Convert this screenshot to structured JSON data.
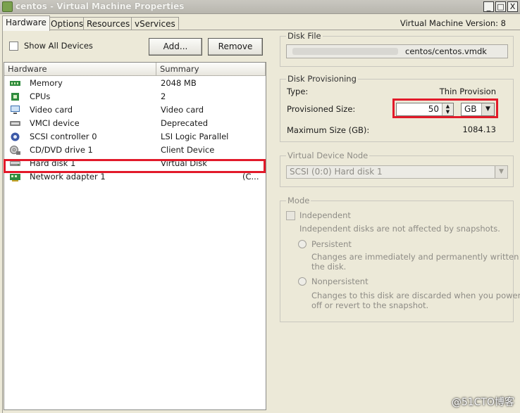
{
  "window": {
    "title": "centos - Virtual Machine Properties",
    "minimize": "_",
    "maximize": "□",
    "close": "X"
  },
  "tabs": [
    {
      "label": "Hardware",
      "active": true
    },
    {
      "label": "Options"
    },
    {
      "label": "Resources"
    },
    {
      "label": "vServices"
    }
  ],
  "vm_version": "Virtual Machine Version: 8",
  "show_all_devices": {
    "label": "Show All Devices",
    "checked": false
  },
  "buttons": {
    "add": "Add...",
    "remove": "Remove"
  },
  "hardware_table": {
    "columns": [
      "Hardware",
      "Summary"
    ],
    "rows": [
      {
        "name": "Memory",
        "summary": "2048 MB",
        "icon": "memory-icon"
      },
      {
        "name": "CPUs",
        "summary": "2",
        "icon": "cpu-icon"
      },
      {
        "name": "Video card",
        "summary": "Video card",
        "icon": "monitor-icon"
      },
      {
        "name": "VMCI device",
        "summary": "Deprecated",
        "icon": "vmci-device-icon"
      },
      {
        "name": "SCSI controller 0",
        "summary": "LSI Logic Parallel",
        "icon": "scsi-controller-icon"
      },
      {
        "name": "CD/DVD drive 1",
        "summary": "Client Device",
        "icon": "cd-dvd-icon"
      },
      {
        "name": "Hard disk 1",
        "summary": "Virtual Disk",
        "icon": "hard-disk-icon",
        "selected": true
      },
      {
        "name": "Network adapter 1",
        "summary": "(C...",
        "icon": "network-adapter-icon"
      }
    ]
  },
  "disk_file": {
    "group_label": "Disk File",
    "value": "centos/centos.vmdk"
  },
  "disk_provisioning": {
    "group_label": "Disk Provisioning",
    "type_label": "Type:",
    "type_value": "Thin Provision",
    "provisioned_label": "Provisioned Size:",
    "provisioned_value": "50",
    "unit": "GB",
    "max_label": "Maximum Size (GB):",
    "max_value": "1084.13"
  },
  "virtual_device_node": {
    "group_label": "Virtual Device Node",
    "value": "SCSI (0:0) Hard disk 1"
  },
  "mode": {
    "group_label": "Mode",
    "independent_label": "Independent",
    "independent_desc": "Independent disks are not affected by snapshots.",
    "persistent_label": "Persistent",
    "persistent_desc_1": "Changes are immediately and permanently written to",
    "persistent_desc_2": "the disk.",
    "nonpersistent_label": "Nonpersistent",
    "nonpersistent_desc_1": "Changes to this disk are discarded when you power",
    "nonpersistent_desc_2": "off or revert to the snapshot."
  },
  "watermark": "@51CTO博客",
  "colors": {
    "highlight_red": "#e21a2a",
    "window_bg": "#ece9d8"
  }
}
